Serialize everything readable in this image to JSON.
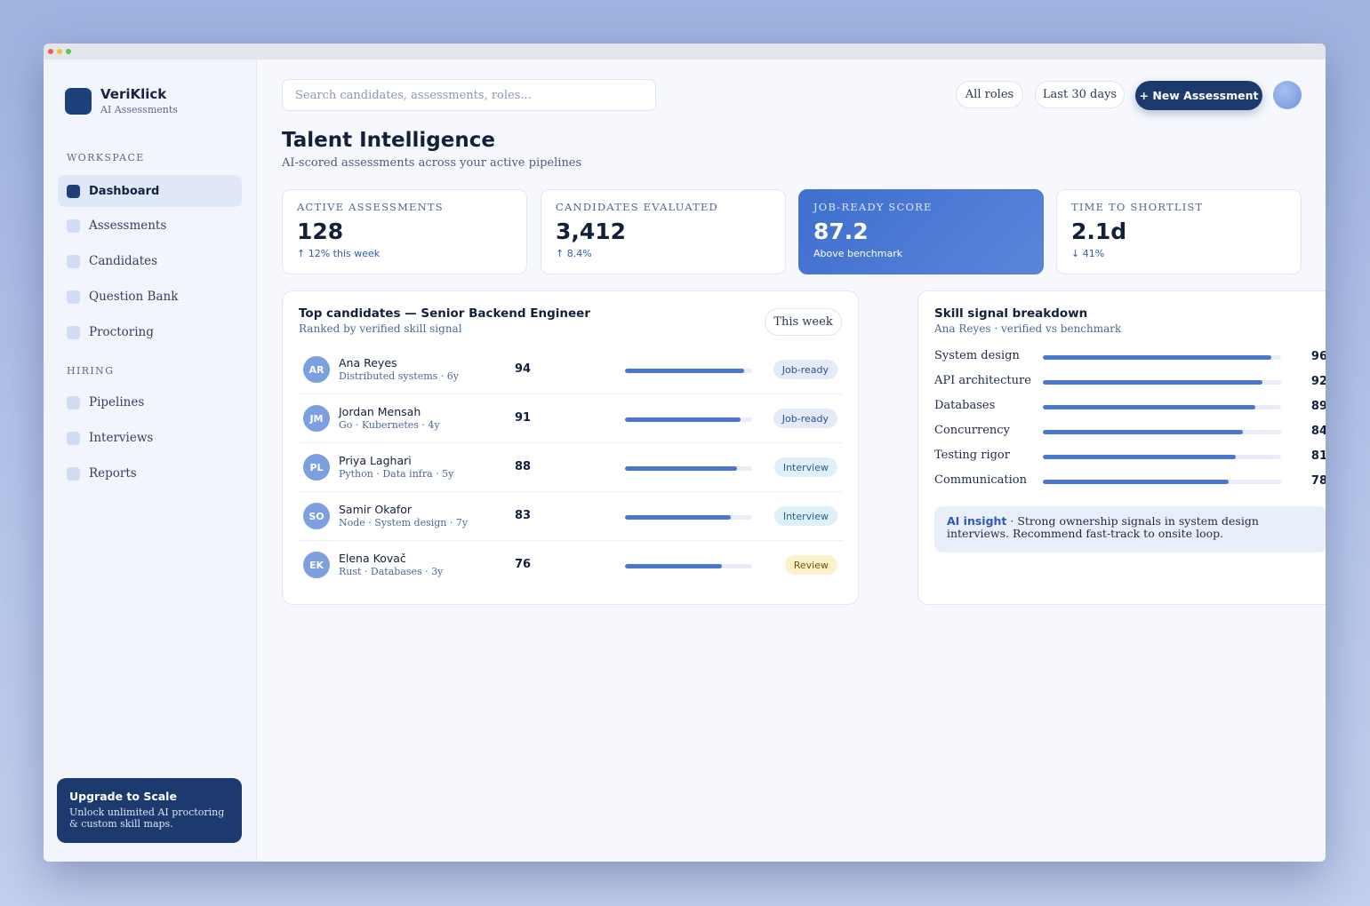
{
  "window": {
    "dots": [
      "#ee5f57",
      "#f5bd3c",
      "#5fc453"
    ]
  },
  "brand": {
    "name": "VeriKlick",
    "subtitle": "AI Assessments"
  },
  "sidebar": {
    "sections": [
      {
        "title": "WORKSPACE",
        "items": [
          {
            "label": "Dashboard",
            "active": true
          },
          {
            "label": "Assessments"
          },
          {
            "label": "Candidates"
          },
          {
            "label": "Question Bank"
          },
          {
            "label": "Proctoring"
          }
        ]
      },
      {
        "title": "HIRING",
        "items": [
          {
            "label": "Pipelines"
          },
          {
            "label": "Interviews"
          },
          {
            "label": "Reports"
          }
        ]
      }
    ],
    "upgrade": {
      "title": "Upgrade to Scale",
      "text": "Unlock unlimited AI proctoring & custom skill maps."
    }
  },
  "header": {
    "search_placeholder": "Search candidates, assessments, roles...",
    "filter_roles": "All roles",
    "filter_range": "Last 30 days",
    "new_button": "+ New Assessment"
  },
  "page": {
    "title": "Talent Intelligence",
    "subtitle": "AI-scored assessments across your active pipelines"
  },
  "stats": [
    {
      "label": "ACTIVE ASSESSMENTS",
      "value": "128",
      "delta": "↑ 12% this week"
    },
    {
      "label": "CANDIDATES EVALUATED",
      "value": "3,412",
      "delta": "↑ 8.4%"
    },
    {
      "label": "JOB-READY SCORE",
      "value": "87.2",
      "delta": "Above benchmark",
      "highlight": true
    },
    {
      "label": "TIME TO SHORTLIST",
      "value": "2.1d",
      "delta": "↓ 41%"
    }
  ],
  "candidates_card": {
    "title": "Top candidates — Senior Backend Engineer",
    "subtitle": "Ranked by verified skill signal",
    "range": "This week",
    "rows": [
      {
        "initials": "AR",
        "name": "Ana Reyes",
        "meta": "Distributed systems · 6y",
        "score": "94",
        "status": "Job-ready",
        "kind": "job"
      },
      {
        "initials": "JM",
        "name": "Jordan Mensah",
        "meta": "Go · Kubernetes · 4y",
        "score": "91",
        "status": "Job-ready",
        "kind": "job"
      },
      {
        "initials": "PL",
        "name": "Priya Laghari",
        "meta": "Python · Data infra · 5y",
        "score": "88",
        "status": "Interview",
        "kind": "int"
      },
      {
        "initials": "SO",
        "name": "Samir Okafor",
        "meta": "Node · System design · 7y",
        "score": "83",
        "status": "Interview",
        "kind": "int"
      },
      {
        "initials": "EK",
        "name": "Elena Kovač",
        "meta": "Rust · Databases · 3y",
        "score": "76",
        "status": "Review",
        "kind": "rev"
      }
    ]
  },
  "skills_card": {
    "title": "Skill signal breakdown",
    "subtitle": "Ana Reyes · verified vs benchmark",
    "skills": [
      {
        "name": "System design",
        "value": "96"
      },
      {
        "name": "API architecture",
        "value": "92"
      },
      {
        "name": "Databases",
        "value": "89"
      },
      {
        "name": "Concurrency",
        "value": "84"
      },
      {
        "name": "Testing rigor",
        "value": "81"
      },
      {
        "name": "Communication",
        "value": "78"
      }
    ],
    "insight_label": "AI insight",
    "insight_text": " · Strong ownership signals in system design interviews. Recommend fast-track to onsite loop."
  }
}
